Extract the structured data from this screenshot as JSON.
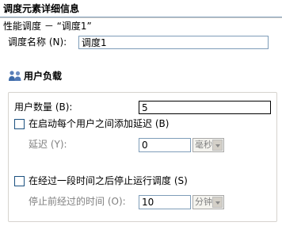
{
  "header": {
    "title": "调度元素详细信息",
    "description": "性能调度 － “调度1”"
  },
  "schedule_name": {
    "label": "调度名称 (N):",
    "value": "调度1"
  },
  "user_load": {
    "heading": "用户负载",
    "icon": "users-icon",
    "user_count": {
      "label": "用户数量 (B):",
      "value": "5"
    },
    "add_delay": {
      "label": "在启动每个用户之间添加延迟 (B)",
      "checked": false
    },
    "delay": {
      "label": "延迟 (Y):",
      "value": "0",
      "unit": "毫秒"
    },
    "stop_after": {
      "label": "在经过一段时间之后停止运行调度 (S)",
      "checked": false
    },
    "elapsed": {
      "label": "停止前经过的时间 (O):",
      "value": "10",
      "unit": "分钟"
    }
  }
}
